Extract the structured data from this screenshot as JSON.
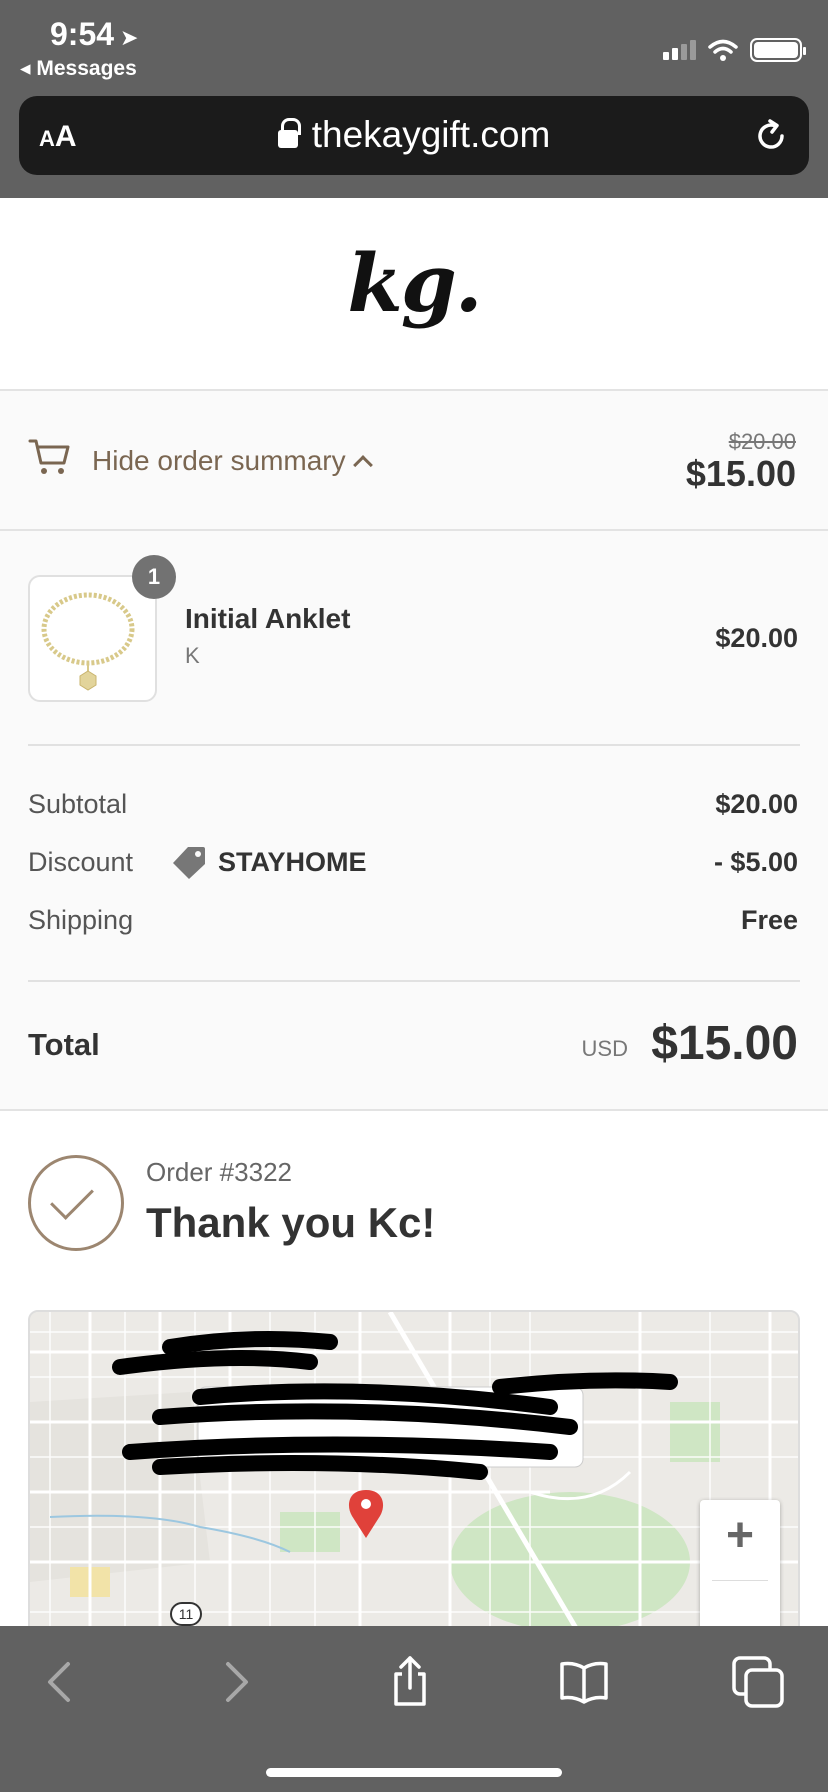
{
  "status_bar": {
    "time": "9:54",
    "back_label": "◂ Messages"
  },
  "browser": {
    "text_size_small": "A",
    "text_size_large": "A",
    "url": "thekaygift.com"
  },
  "site": {
    "logo_text": "kg."
  },
  "summary_toggle": {
    "label": "Hide order summary",
    "original_total": "$20.00",
    "total": "$15.00"
  },
  "line_item": {
    "quantity": "1",
    "name": "Initial Anklet",
    "variant": "K",
    "price": "$20.00"
  },
  "totals": {
    "subtotal_label": "Subtotal",
    "subtotal_value": "$20.00",
    "discount_label": "Discount",
    "discount_code": "STAYHOME",
    "discount_value": "- $5.00",
    "shipping_label": "Shipping",
    "shipping_value": "Free",
    "total_label": "Total",
    "currency": "USD",
    "total_value": "$15.00"
  },
  "confirmation": {
    "order_number": "Order #3322",
    "thank_you": "Thank you Kc!"
  },
  "map": {
    "road_marker": "11",
    "zoom_in_label": "+"
  },
  "colors": {
    "accent": "#7a6651",
    "chrome": "#616161",
    "pin": "#e0413a"
  }
}
